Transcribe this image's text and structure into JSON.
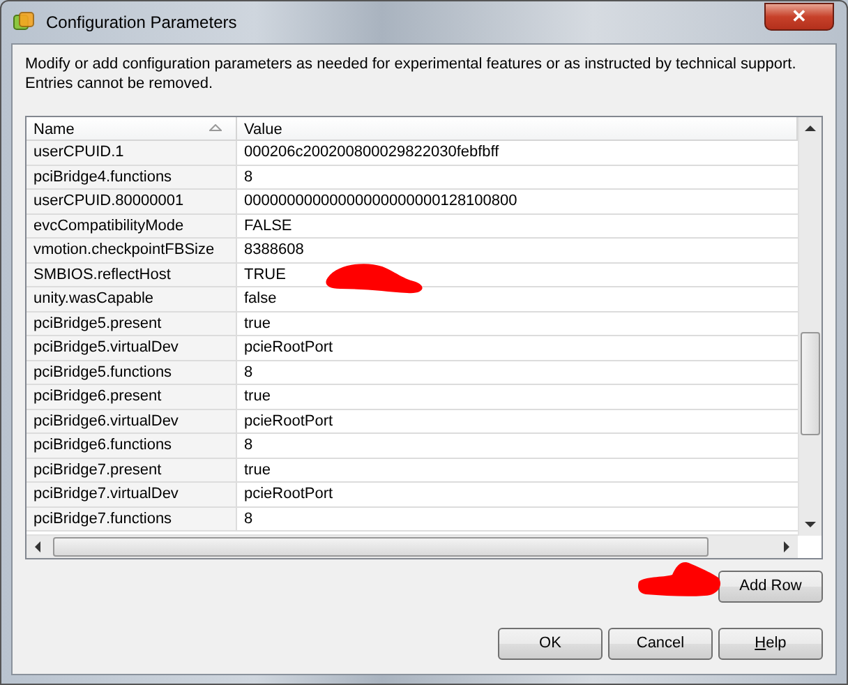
{
  "window": {
    "title": "Configuration Parameters",
    "close": "✕"
  },
  "description": "Modify or add configuration parameters as needed for experimental features or as instructed by technical support. Entries cannot be removed.",
  "table": {
    "columns": [
      {
        "label": "Name",
        "sorted": true
      },
      {
        "label": "Value",
        "sorted": false
      }
    ],
    "rows": [
      [
        "userCPUID.1",
        "000206c200200800029822030febfbff"
      ],
      [
        "pciBridge4.functions",
        "8"
      ],
      [
        "userCPUID.80000001",
        "00000000000000000000000128100800"
      ],
      [
        "evcCompatibilityMode",
        "FALSE"
      ],
      [
        "vmotion.checkpointFBSize",
        "8388608"
      ],
      [
        "SMBIOS.reflectHost",
        "TRUE"
      ],
      [
        "unity.wasCapable",
        "false"
      ],
      [
        "pciBridge5.present",
        "true"
      ],
      [
        "pciBridge5.virtualDev",
        "pcieRootPort"
      ],
      [
        "pciBridge5.functions",
        "8"
      ],
      [
        "pciBridge6.present",
        "true"
      ],
      [
        "pciBridge6.virtualDev",
        "pcieRootPort"
      ],
      [
        "pciBridge6.functions",
        "8"
      ],
      [
        "pciBridge7.present",
        "true"
      ],
      [
        "pciBridge7.virtualDev",
        "pcieRootPort"
      ],
      [
        "pciBridge7.functions",
        "8"
      ]
    ]
  },
  "add_button": "Add Row",
  "buttons": [
    {
      "label": "OK",
      "underlined": false
    },
    {
      "label": "Cancel",
      "underlined": false
    },
    {
      "label": "Help",
      "underlined": true
    }
  ]
}
